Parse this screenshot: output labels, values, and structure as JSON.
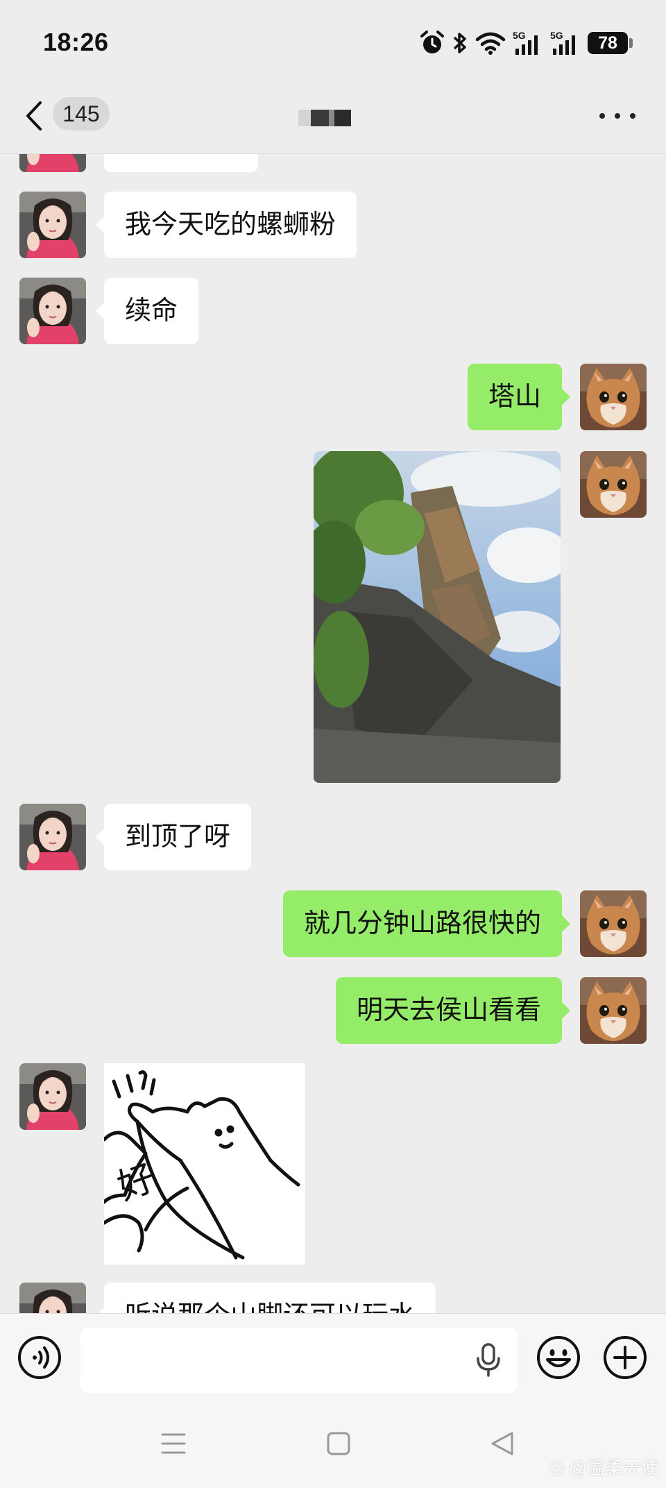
{
  "status_bar": {
    "time": "18:26",
    "network_labels": [
      "5G",
      "5G"
    ],
    "battery": "78",
    "icons": [
      "alarm-icon",
      "bluetooth-icon",
      "wifi-icon",
      "signal-icon",
      "signal-icon",
      "battery-icon"
    ]
  },
  "nav": {
    "unread_count": "145",
    "title_redacted": true,
    "icons": [
      "back-icon",
      "more-icon"
    ]
  },
  "messages": [
    {
      "side": "in",
      "type": "text",
      "text": ""
    },
    {
      "side": "in",
      "type": "text",
      "text": "我今天吃的螺蛳粉"
    },
    {
      "side": "in",
      "type": "text",
      "text": "续命"
    },
    {
      "side": "out",
      "type": "text",
      "text": "塔山"
    },
    {
      "side": "out",
      "type": "image",
      "description_icon": "photo-pagoda-image"
    },
    {
      "side": "in",
      "type": "text",
      "text": "到顶了呀"
    },
    {
      "side": "out",
      "type": "text",
      "text": "就几分钟山路很快的"
    },
    {
      "side": "out",
      "type": "text",
      "text": "明天去侯山看看"
    },
    {
      "side": "in",
      "type": "sticker",
      "sticker_text": "好"
    },
    {
      "side": "in",
      "type": "text",
      "text": "听说那个山脚还可以玩水"
    }
  ],
  "input_bar": {
    "value": "",
    "icons": [
      "voice-icon",
      "mic-icon",
      "emoji-icon",
      "plus-icon"
    ]
  },
  "system_nav": {
    "icons": [
      "menu-icon",
      "home-icon",
      "back-triangle-icon"
    ],
    "watermark": "@温柔天使"
  },
  "colors": {
    "background": "#ededed",
    "bubble_out": "#95ec69",
    "bubble_in": "#ffffff"
  }
}
